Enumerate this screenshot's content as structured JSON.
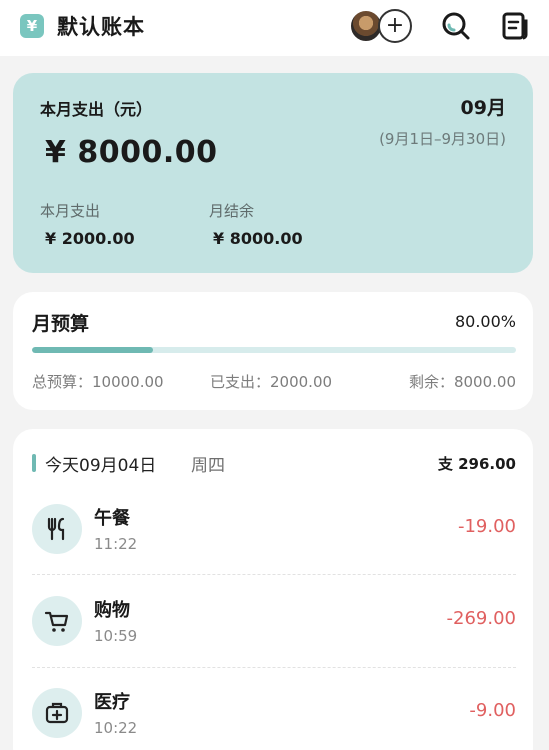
{
  "header": {
    "title": "默认账本",
    "logo_glyph": "¥",
    "add_glyph": "+"
  },
  "summary": {
    "label": "本月支出（元）",
    "month": "09月",
    "range": "(9月1日–9月30日)",
    "amount": "¥ 8000.00",
    "left_label": "本月支出",
    "left_value": "¥ 2000.00",
    "right_label": "月结余",
    "right_value": "¥ 8000.00"
  },
  "budget": {
    "title": "月预算",
    "percent": "80.00%",
    "progress": 0.25,
    "total": "总预算：10000.00",
    "spent": "已支出：2000.00",
    "remaining": "剩余：8000.00"
  },
  "day": {
    "date": "今天09月04日",
    "weekday": "周四",
    "total": "支 296.00"
  },
  "transactions": [
    {
      "category": "午餐",
      "time": "11:22",
      "amount": "-19.00",
      "icon": "utensils-icon"
    },
    {
      "category": "购物",
      "time": "10:59",
      "amount": "-269.00",
      "icon": "cart-icon"
    },
    {
      "category": "医疗",
      "time": "10:22",
      "amount": "-9.00",
      "icon": "medical-kit-icon"
    }
  ],
  "colors": {
    "accent": "#6fb9b3",
    "summary_bg": "#c3e3e2",
    "expense": "#e06060"
  }
}
